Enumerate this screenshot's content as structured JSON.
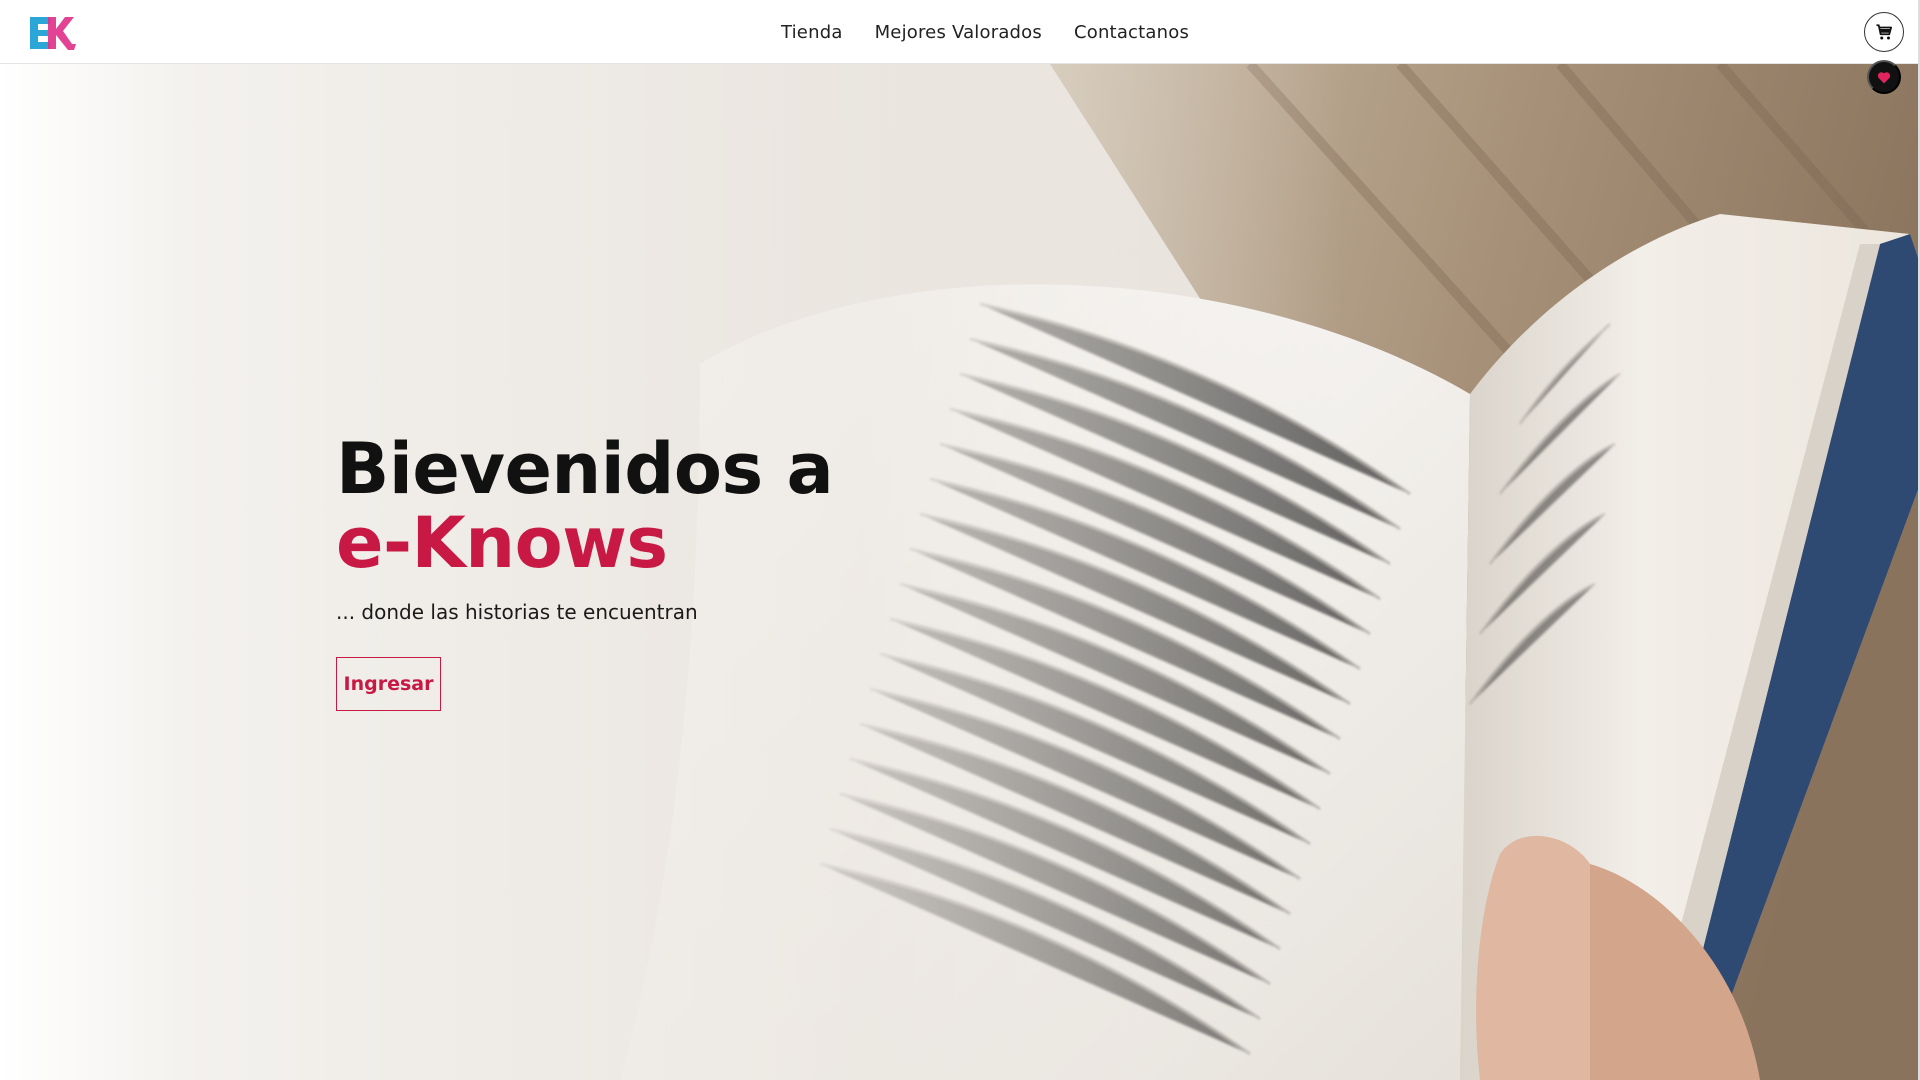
{
  "brand": {
    "logo_text": "EK",
    "logo_icon": "ek-logo-icon"
  },
  "nav": {
    "links": [
      {
        "label": "Tienda"
      },
      {
        "label": "Mejores Valorados"
      },
      {
        "label": "Contactanos"
      }
    ]
  },
  "actions": {
    "cart_icon": "cart-icon",
    "favorites_icon": "heart-icon"
  },
  "hero": {
    "title_line1": "Bievenidos a",
    "title_line2": "e-Knows",
    "subtitle": "... donde las historias te encuentran",
    "cta_label": "Ingresar",
    "background_image": "open-book-photo"
  },
  "colors": {
    "accent": "#c81844",
    "text": "#111111",
    "navbar_bg": "#ffffff",
    "logo_blue": "#2aa7d6",
    "logo_pink": "#e0338a"
  }
}
